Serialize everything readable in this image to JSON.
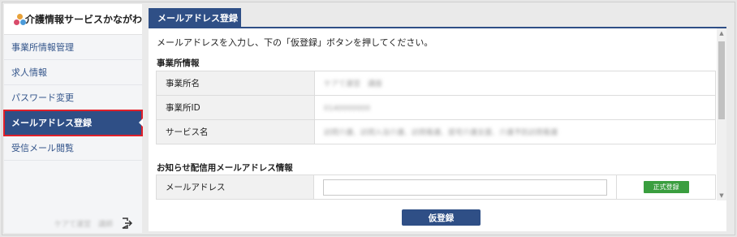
{
  "brand": {
    "name": "介護情報サービスかながわ",
    "logo_icon": "flower-logo-icon"
  },
  "sidebar": {
    "items": [
      {
        "label": "事業所情報管理",
        "active": false
      },
      {
        "label": "求人情報",
        "active": false
      },
      {
        "label": "パスワード変更",
        "active": false
      },
      {
        "label": "メールアドレス登録",
        "active": true
      },
      {
        "label": "受信メール閲覧",
        "active": false
      }
    ],
    "footer": {
      "user_name": "ケアて運営　講師",
      "logout_icon": "logout-icon"
    }
  },
  "main": {
    "tab_label": "メールアドレス登録",
    "instruction": "メールアドレスを入力し、下の「仮登録」ボタンを押してください。",
    "office_section": {
      "title": "事業所情報",
      "rows": [
        {
          "label": "事業所名",
          "value": "ケアて運営　講座"
        },
        {
          "label": "事業所ID",
          "value": "0140000000"
        },
        {
          "label": "サービス名",
          "value": "訪問介護、訪問入浴介護、訪問看護、居宅介護支援、介護予防訪問看護"
        }
      ]
    },
    "email_section": {
      "title": "お知らせ配信用メールアドレス情報",
      "row_label": "メールアドレス",
      "email_value": "",
      "badge_label": "正式登録"
    },
    "register_button": "仮登録"
  },
  "colors": {
    "accent": "#2f4f86",
    "highlight": "#e0202a",
    "badge": "#3a9e3f"
  }
}
